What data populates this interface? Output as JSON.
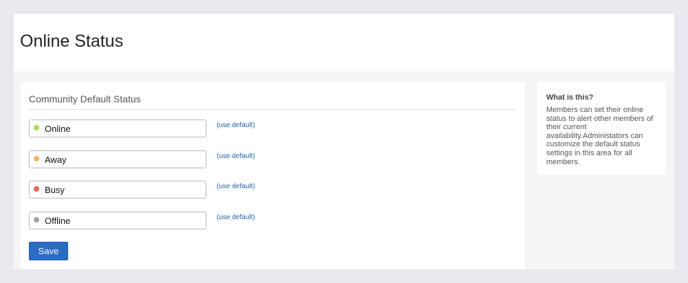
{
  "page": {
    "title": "Online Status"
  },
  "main": {
    "section_title": "Community Default Status",
    "statuses": [
      {
        "value": "Online",
        "dot_color": "#a8dc57",
        "default_link": "(use default)"
      },
      {
        "value": "Away",
        "dot_color": "#eeb35c",
        "default_link": "(use default)"
      },
      {
        "value": "Busy",
        "dot_color": "#e8635e",
        "default_link": "(use default)"
      },
      {
        "value": "Offline",
        "dot_color": "#a2a2a2",
        "default_link": "(use default)"
      }
    ],
    "save_label": "Save"
  },
  "sidebar": {
    "title": "What is this?",
    "text": "Members can set their online status to alert other members of their current availability.Administators can customize the default status settings in this area for all members."
  },
  "colors": {
    "accent": "#2b6cc4",
    "link": "#1f5fa8"
  }
}
